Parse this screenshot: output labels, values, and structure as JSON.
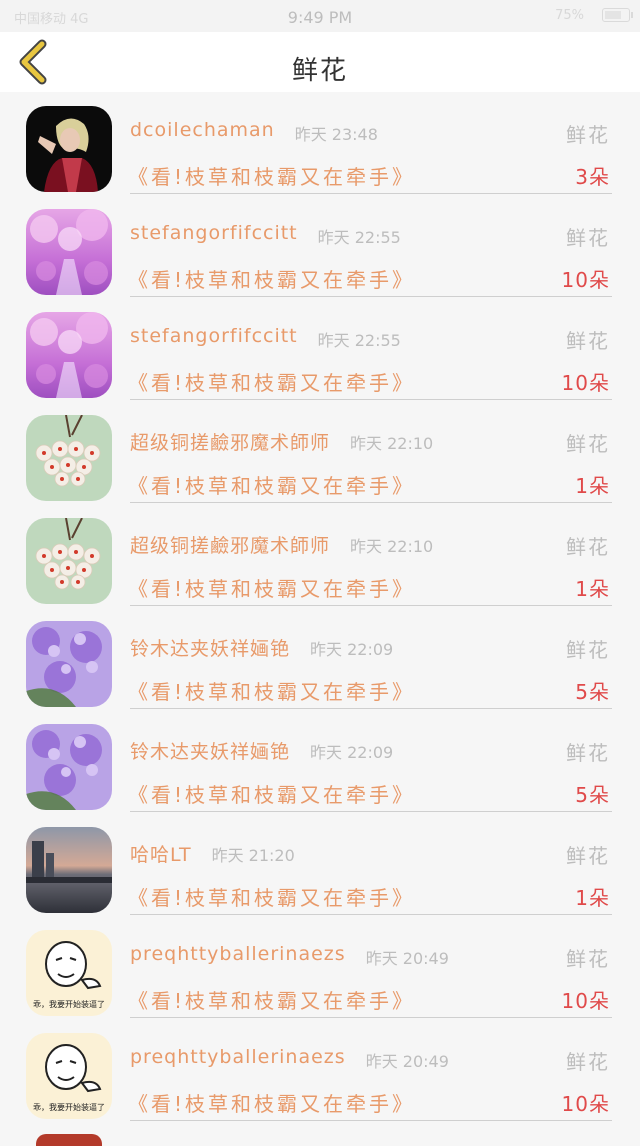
{
  "status_bar": {
    "carrier": "中国移动 4G",
    "time": "9:49 PM",
    "battery_percent": "75%"
  },
  "header": {
    "title": "鲜花"
  },
  "list": [
    {
      "user": "dcoilechaman",
      "time": "昨天 23:48",
      "gift": "鲜花",
      "post": "《看!枝草和枝霸又在牵手》",
      "count": "3朵",
      "avatar": "woman-icon"
    },
    {
      "user": "stefangorfifccitt",
      "time": "昨天 22:55",
      "gift": "鲜花",
      "post": "《看!枝草和枝霸又在牵手》",
      "count": "10朵",
      "avatar": "pink-blossom-icon"
    },
    {
      "user": "stefangorfifccitt",
      "time": "昨天 22:55",
      "gift": "鲜花",
      "post": "《看!枝草和枝霸又在牵手》",
      "count": "10朵",
      "avatar": "pink-blossom-icon"
    },
    {
      "user": "超级铜搓鹼邪魔术師师",
      "time": "昨天 22:10",
      "gift": "鲜花",
      "post": "《看!枝草和枝霸又在牵手》",
      "count": "1朵",
      "avatar": "hoya-flower-icon"
    },
    {
      "user": "超级铜搓鹼邪魔术師师",
      "time": "昨天 22:10",
      "gift": "鲜花",
      "post": "《看!枝草和枝霸又在牵手》",
      "count": "1朵",
      "avatar": "hoya-flower-icon"
    },
    {
      "user": "铃木达夹妖祥婳铯",
      "time": "昨天 22:09",
      "gift": "鲜花",
      "post": "《看!枝草和枝霸又在牵手》",
      "count": "5朵",
      "avatar": "lilac-icon"
    },
    {
      "user": "铃木达夹妖祥婳铯",
      "time": "昨天 22:09",
      "gift": "鲜花",
      "post": "《看!枝草和枝霸又在牵手》",
      "count": "5朵",
      "avatar": "lilac-icon"
    },
    {
      "user": "哈哈LT",
      "time": "昨天 21:20",
      "gift": "鲜花",
      "post": "《看!枝草和枝霸又在牵手》",
      "count": "1朵",
      "avatar": "sunset-city-icon"
    },
    {
      "user": "preqhttyballerinaezs",
      "time": "昨天 20:49",
      "gift": "鲜花",
      "post": "《看!枝草和枝霸又在牵手》",
      "count": "10朵",
      "avatar": "meme-face-icon"
    },
    {
      "user": "preqhttyballerinaezs",
      "time": "昨天 20:49",
      "gift": "鲜花",
      "post": "《看!枝草和枝霸又在牵手》",
      "count": "10朵",
      "avatar": "meme-face-icon"
    }
  ],
  "meme_caption": "乖，我要开始装逼了",
  "colors": {
    "accent": "#e89a6a",
    "count": "#e04a4a",
    "muted": "#bdbdbd",
    "back_arrow": "#e8c640"
  }
}
